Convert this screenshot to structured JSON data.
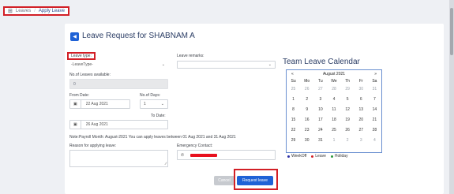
{
  "breadcrumb": {
    "icon": "grid-icon",
    "parent": "Leaves",
    "separator": "/",
    "current": "Apply Leave"
  },
  "page": {
    "title": "Leave Request for SHABNAM A",
    "back_icon": "back-arrow-icon"
  },
  "form": {
    "leave_type_label": "Leave type:",
    "leave_type_value": "-LeaveType-",
    "leave_remarks_label": "Leave remarks:",
    "leaves_available_label": "No.of Leaves available:",
    "leaves_available_value": "0",
    "from_date_label": "From Date:",
    "from_date_value": "22 Aug 2021",
    "no_of_days_label": "No.of Days:",
    "no_of_days_value": "1",
    "to_date_label": "To Date:",
    "to_date_value": "26 Aug 2021",
    "payroll_note": "Note:Payroll Month: August-2021 You can apply leaves between 01 Aug 2021 and 31 Aug 2021",
    "reason_label": "Reason for applying leave:",
    "emergency_label": "Emergency Contact:"
  },
  "buttons": {
    "cancel": "Cancel",
    "request": "Request leave"
  },
  "calendar": {
    "title": "Team Leave Calendar",
    "month": "August 2021",
    "prev": "«",
    "next": "»",
    "weekdays": [
      "Su",
      "Mo",
      "Tu",
      "We",
      "Th",
      "Fr",
      "Sa"
    ],
    "weeks": [
      [
        "25",
        "26",
        "27",
        "28",
        "29",
        "30",
        "31"
      ],
      [
        "1",
        "2",
        "3",
        "4",
        "5",
        "6",
        "7"
      ],
      [
        "8",
        "9",
        "10",
        "11",
        "12",
        "13",
        "14"
      ],
      [
        "15",
        "16",
        "17",
        "18",
        "19",
        "20",
        "21"
      ],
      [
        "22",
        "23",
        "24",
        "25",
        "26",
        "27",
        "28"
      ],
      [
        "29",
        "30",
        "31",
        "1",
        "2",
        "3",
        "4"
      ]
    ],
    "muted_cells": [
      [
        0,
        0
      ],
      [
        0,
        1
      ],
      [
        0,
        2
      ],
      [
        0,
        3
      ],
      [
        0,
        4
      ],
      [
        0,
        5
      ],
      [
        0,
        6
      ],
      [
        5,
        3
      ],
      [
        5,
        4
      ],
      [
        5,
        5
      ],
      [
        5,
        6
      ]
    ]
  },
  "legend": [
    {
      "label": "WeekOff",
      "color": "#2a2fa8"
    },
    {
      "label": "Leave",
      "color": "#d21f26"
    },
    {
      "label": "Holiday",
      "color": "#2e9a3e"
    }
  ]
}
